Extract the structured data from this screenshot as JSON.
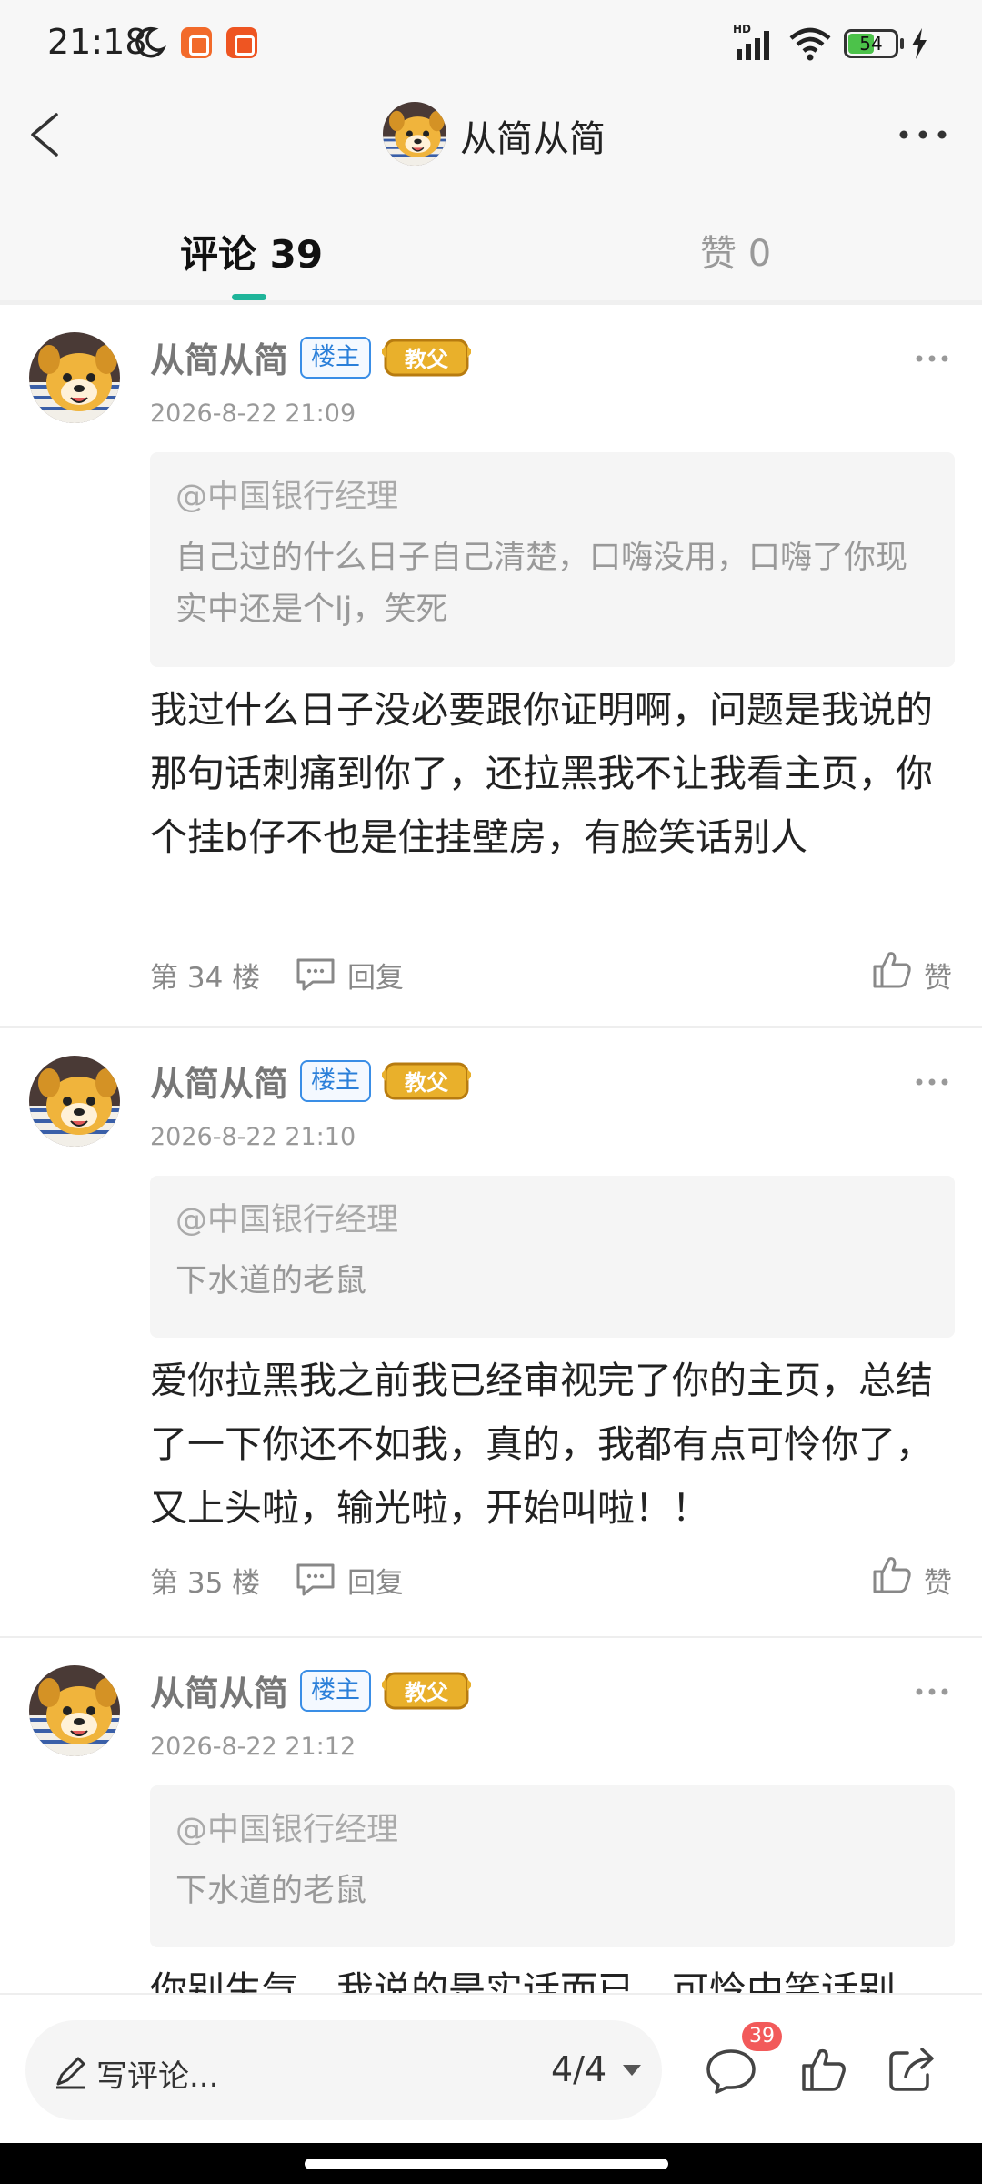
{
  "status_bar": {
    "time": "21:18",
    "battery_level": "54",
    "network": "HD"
  },
  "header": {
    "title": "从简从简",
    "back_icon": "chevron-left-icon",
    "more_icon": "more-horizontal-icon"
  },
  "tabs": [
    {
      "label": "评论 39",
      "active": true
    },
    {
      "label": "赞 0",
      "active": false
    }
  ],
  "colors": {
    "accent": "#1fb59a",
    "owner_badge": "#2a7fd9",
    "notification": "#f25a5a"
  },
  "comments": [
    {
      "author": "从简从简",
      "owner_badge": "楼主",
      "title_badge": "教父",
      "timestamp": "2026-8-22 21:09",
      "quote_target": "@中国银行经理",
      "quote_text": "自己过的什么日子自己清楚，口嗨没用，口嗨了你现实中还是个lj，笑死",
      "text": "我过什么日子没必要跟你证明啊，问题是我说的那句话刺痛到你了，还拉黑我不让我看主页，你个挂b仔不也是住挂壁房，有脸笑话别人",
      "floor": "第 34 楼",
      "reply_label": "回复",
      "like_label": "赞"
    },
    {
      "author": "从简从简",
      "owner_badge": "楼主",
      "title_badge": "教父",
      "timestamp": "2026-8-22 21:10",
      "quote_target": "@中国银行经理",
      "quote_text": "下水道的老鼠",
      "text": "爱你拉黑我之前我已经审视完了你的主页，总结了一下你还不如我，真的，我都有点可怜你了，又上头啦，输光啦，开始叫啦！！",
      "floor": "第 35 楼",
      "reply_label": "回复",
      "like_label": "赞"
    },
    {
      "author": "从简从简",
      "owner_badge": "楼主",
      "title_badge": "教父",
      "timestamp": "2026-8-22 21:12",
      "quote_target": "@中国银行经理",
      "quote_text": "下水道的老鼠",
      "text": "你别生气，我说的是实话而已，可怜中笑话别",
      "floor": "",
      "reply_label": "",
      "like_label": ""
    }
  ],
  "bottom_bar": {
    "write_placeholder": "写评论...",
    "page_indicator": "4/4",
    "comment_count": "39"
  }
}
